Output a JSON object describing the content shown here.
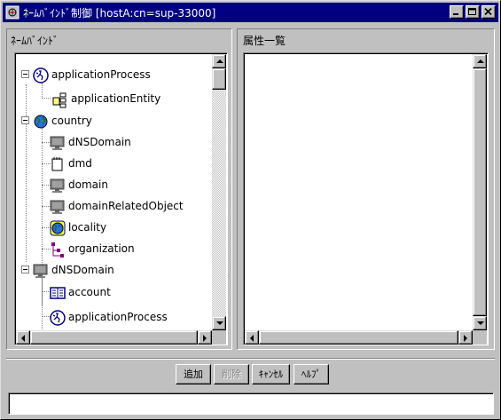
{
  "window": {
    "title": "ﾈｰﾑﾊﾞｲﾝﾄﾞ制御 [hostA:cn=sup-33000]"
  },
  "left_panel": {
    "title": "ﾈｰﾑﾊﾞｲﾝﾄﾞ",
    "tree": [
      {
        "label": "applicationProcess",
        "icon": "application-process-icon",
        "level": 0,
        "expanded": true
      },
      {
        "label": "applicationEntity",
        "icon": "application-entity-icon",
        "level": 1
      },
      {
        "label": "country",
        "icon": "globe-icon",
        "level": 0,
        "expanded": true
      },
      {
        "label": "dNSDomain",
        "icon": "monitor-icon",
        "level": 1
      },
      {
        "label": "dmd",
        "icon": "document-icon",
        "level": 1
      },
      {
        "label": "domain",
        "icon": "monitor-icon",
        "level": 1
      },
      {
        "label": "domainRelatedObject",
        "icon": "monitor-icon",
        "level": 1
      },
      {
        "label": "locality",
        "icon": "locality-icon",
        "level": 1
      },
      {
        "label": "organization",
        "icon": "organization-icon",
        "level": 1
      },
      {
        "label": "dNSDomain",
        "icon": "monitor-icon",
        "level": 0,
        "expanded": true
      },
      {
        "label": "account",
        "icon": "account-icon",
        "level": 1
      },
      {
        "label": "applicationProcess",
        "icon": "application-process-icon",
        "level": 1
      }
    ]
  },
  "right_panel": {
    "title": "属性一覧"
  },
  "buttons": {
    "add": "追加",
    "delete": "削除",
    "cancel": "ｷｬﾝｾﾙ",
    "help": "ﾍﾙﾌﾟ"
  },
  "status": {
    "text": ""
  },
  "colors": {
    "titlebar": "#000080",
    "face": "#c0c0c0"
  }
}
